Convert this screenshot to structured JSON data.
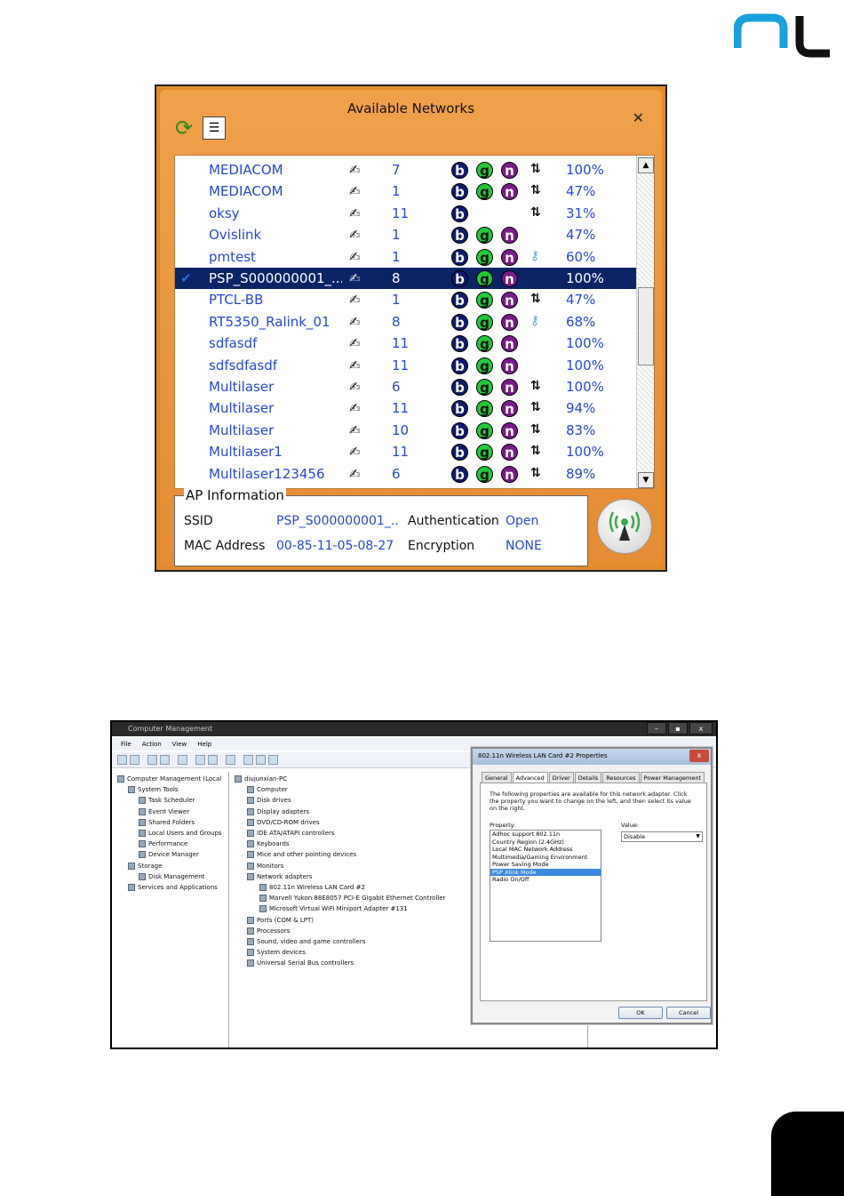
{
  "available_networks": {
    "title": "Available Networks",
    "close_label": "✕",
    "networks": [
      {
        "ssid": "MEDIACOM",
        "channel": "7",
        "b": "b",
        "g": "g",
        "n": "n",
        "security": "adhoc",
        "signal": "100%",
        "selected": false
      },
      {
        "ssid": "MEDIACOM",
        "channel": "1",
        "b": "b",
        "g": "g",
        "n": "n",
        "security": "adhoc",
        "signal": "47%",
        "selected": false
      },
      {
        "ssid": "oksy",
        "channel": "11",
        "b": "b",
        "g": "",
        "n": "",
        "security": "adhoc",
        "signal": "31%",
        "selected": false
      },
      {
        "ssid": "Ovislink",
        "channel": "1",
        "b": "b",
        "g": "g",
        "n": "n",
        "security": "",
        "signal": "47%",
        "selected": false
      },
      {
        "ssid": "pmtest",
        "channel": "1",
        "b": "b",
        "g": "g",
        "n": "n",
        "security": "key",
        "signal": "60%",
        "selected": false
      },
      {
        "ssid": "PSP_S000000001_...",
        "channel": "8",
        "b": "b",
        "g": "g",
        "n": "n",
        "security": "",
        "signal": "100%",
        "selected": true
      },
      {
        "ssid": "PTCL-BB",
        "channel": "1",
        "b": "b",
        "g": "g",
        "n": "n",
        "security": "adhoc",
        "signal": "47%",
        "selected": false
      },
      {
        "ssid": "RT5350_Ralink_01",
        "channel": "8",
        "b": "b",
        "g": "g",
        "n": "n",
        "security": "key",
        "signal": "68%",
        "selected": false
      },
      {
        "ssid": "sdfasdf",
        "channel": "11",
        "b": "b",
        "g": "g",
        "n": "n",
        "security": "",
        "signal": "100%",
        "selected": false
      },
      {
        "ssid": "sdfsdfasdf",
        "channel": "11",
        "b": "b",
        "g": "g",
        "n": "n",
        "security": "",
        "signal": "100%",
        "selected": false
      },
      {
        "ssid": "Multilaser",
        "channel": "6",
        "b": "b",
        "g": "g",
        "n": "n",
        "security": "adhoc",
        "signal": "100%",
        "selected": false
      },
      {
        "ssid": "Multilaser",
        "channel": "11",
        "b": "b",
        "g": "g",
        "n": "n",
        "security": "adhoc",
        "signal": "94%",
        "selected": false
      },
      {
        "ssid": "Multilaser",
        "channel": "10",
        "b": "b",
        "g": "g",
        "n": "n",
        "security": "adhoc",
        "signal": "83%",
        "selected": false
      },
      {
        "ssid": "Multilaser1",
        "channel": "11",
        "b": "b",
        "g": "g",
        "n": "n",
        "security": "adhoc",
        "signal": "100%",
        "selected": false
      },
      {
        "ssid": "Multilaser123456",
        "channel": "6",
        "b": "b",
        "g": "g",
        "n": "n",
        "security": "adhoc",
        "signal": "89%",
        "selected": false
      }
    ],
    "ap_info": {
      "legend": "AP Information",
      "ssid_label": "SSID",
      "ssid_value": "PSP_S000000001_..",
      "auth_label": "Authentication",
      "auth_value": "Open",
      "mac_label": "MAC Address",
      "mac_value": "00-85-11-05-08-27",
      "enc_label": "Encryption",
      "enc_value": "NONE"
    }
  },
  "computer_management": {
    "title": "Computer Management",
    "controls": [
      "–",
      "▪",
      "x"
    ],
    "menu": [
      "File",
      "Action",
      "View",
      "Help"
    ],
    "left_tree": [
      {
        "label": "Computer Management (Local",
        "level": 0
      },
      {
        "label": "System Tools",
        "level": 1
      },
      {
        "label": "Task Scheduler",
        "level": 2
      },
      {
        "label": "Event Viewer",
        "level": 2
      },
      {
        "label": "Shared Folders",
        "level": 2
      },
      {
        "label": "Local Users and Groups",
        "level": 2
      },
      {
        "label": "Performance",
        "level": 2
      },
      {
        "label": "Device Manager",
        "level": 2
      },
      {
        "label": "Storage",
        "level": 1
      },
      {
        "label": "Disk Management",
        "level": 2
      },
      {
        "label": "Services and Applications",
        "level": 1
      }
    ],
    "device_tree": [
      {
        "label": "diujunxian-PC",
        "level": 0
      },
      {
        "label": "Computer",
        "level": 1
      },
      {
        "label": "Disk drives",
        "level": 1
      },
      {
        "label": "Display adapters",
        "level": 1
      },
      {
        "label": "DVD/CD-ROM drives",
        "level": 1
      },
      {
        "label": "IDE ATA/ATAPI controllers",
        "level": 1
      },
      {
        "label": "Keyboards",
        "level": 1
      },
      {
        "label": "Mice and other pointing devices",
        "level": 1
      },
      {
        "label": "Monitors",
        "level": 1
      },
      {
        "label": "Network adapters",
        "level": 1
      },
      {
        "label": "802.11n Wireless LAN Card #2",
        "level": 2
      },
      {
        "label": "Marvell Yukon 88E8057 PCI-E Gigabit Ethernet Controller",
        "level": 2
      },
      {
        "label": "Microsoft Virtual WiFi Miniport Adapter #131",
        "level": 2
      },
      {
        "label": "Ports (COM & LPT)",
        "level": 1
      },
      {
        "label": "Processors",
        "level": 1
      },
      {
        "label": "Sound, video and game controllers",
        "level": 1
      },
      {
        "label": "System devices",
        "level": 1
      },
      {
        "label": "Universal Serial Bus controllers",
        "level": 1
      }
    ],
    "dialog": {
      "title": "802.11n Wireless LAN Card #2 Properties",
      "close": "x",
      "tabs": [
        "General",
        "Advanced",
        "Driver",
        "Details",
        "Resources",
        "Power Management"
      ],
      "active_tab": "Advanced",
      "description": "The following properties are available for this network adapter. Click the property you want to change on the left, and then select its value on the right.",
      "property_label": "Property:",
      "properties": [
        "Adhoc support 802.11n",
        "Country Region (2.4GHz)",
        "Local MAC Network Address",
        "Multimedia/Gaming Environment",
        "Power Saving Mode",
        "PSP Xlink Mode",
        "Radio On/Off"
      ],
      "selected_property": "PSP Xlink Mode",
      "value_label": "Value:",
      "value": "Disable",
      "ok": "OK",
      "cancel": "Cancel"
    }
  },
  "colors": {
    "brand_blue": "#1a9ad8",
    "orange": "#e58c34",
    "selected_row": "#0a2466",
    "link_blue": "#2848d8"
  }
}
